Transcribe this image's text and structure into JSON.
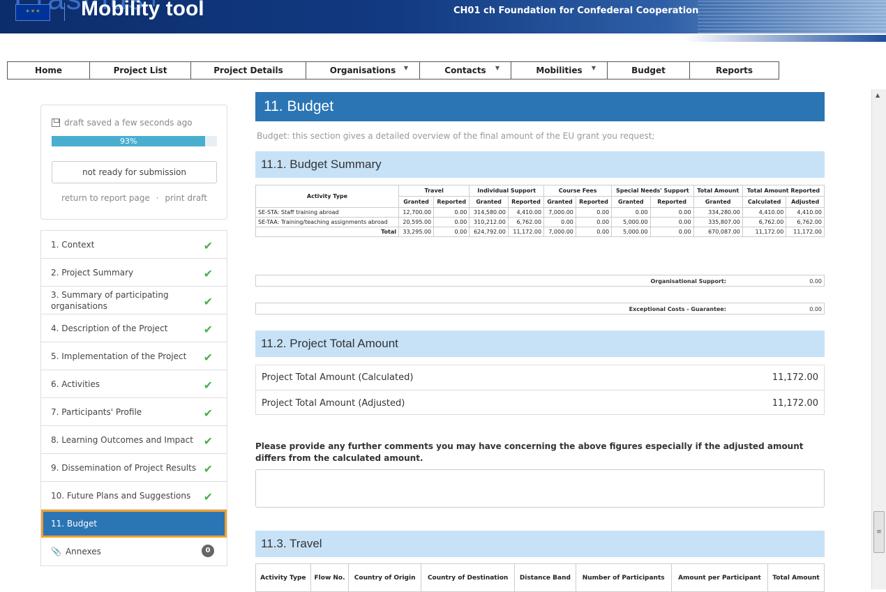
{
  "banner": {
    "ghost_text": "Erasmus+",
    "flag": "* * *",
    "app_name": "Mobility tool",
    "organisation": "CH01 ch Foundation for Confederal Cooperation"
  },
  "nav": {
    "items": [
      {
        "label": "Home"
      },
      {
        "label": "Project List"
      },
      {
        "label": "Project Details"
      },
      {
        "label": "Organisations"
      },
      {
        "label": "Contacts"
      },
      {
        "label": "Mobilities"
      },
      {
        "label": "Budget"
      },
      {
        "label": "Reports"
      }
    ],
    "caret": "▼"
  },
  "status": {
    "saved_text": "draft saved a few seconds ago",
    "progress_text": "93%",
    "progress_value": 93,
    "submission_label": "not ready for submission",
    "return_link": "return to report page",
    "separator": "·",
    "print_link": "print draft"
  },
  "sections": [
    {
      "label": "1. Context",
      "check": "✔"
    },
    {
      "label": "2. Project Summary",
      "check": "✔"
    },
    {
      "label": "3. Summary of participating organisations",
      "check": "✔"
    },
    {
      "label": "4. Description of the Project",
      "check": "✔"
    },
    {
      "label": "5. Implementation of the Project",
      "check": "✔"
    },
    {
      "label": "6. Activities",
      "check": "✔"
    },
    {
      "label": "7. Participants' Profile",
      "check": "✔"
    },
    {
      "label": "8. Learning Outcomes and Impact",
      "check": "✔"
    },
    {
      "label": "9. Dissemination of Project Results",
      "check": "✔"
    },
    {
      "label": "10. Future Plans and Suggestions",
      "check": "✔"
    },
    {
      "label": "11. Budget"
    },
    {
      "label": "Annexes",
      "count": "0"
    }
  ],
  "main": {
    "title": "11. Budget",
    "intro": "Budget: this section gives a detailed overview of the final amount of the EU grant you request;",
    "summary_heading": "11.1. Budget Summary",
    "summary_table": {
      "group_headers": {
        "activity_type": "Activity Type",
        "travel": "Travel",
        "individual_support": "Individual Support",
        "course_fees": "Course Fees",
        "special_needs": "Special Needs' Support",
        "total_amount": "Total Amount",
        "total_reported": "Total Amount Reported"
      },
      "sub_headers": {
        "granted": "Granted",
        "reported": "Reported",
        "calculated": "Calculated",
        "adjusted": "Adjusted"
      },
      "rows": [
        {
          "label": "SE-STA: Staff training abroad",
          "cells": [
            "12,700.00",
            "0.00",
            "314,580.00",
            "4,410.00",
            "7,000.00",
            "0.00",
            "0.00",
            "0.00",
            "334,280.00",
            "4,410.00",
            "4,410.00"
          ]
        },
        {
          "label": "SE-TAA: Training/teaching assignments abroad",
          "cells": [
            "20,595.00",
            "0.00",
            "310,212.00",
            "6,762.00",
            "0.00",
            "0.00",
            "5,000.00",
            "0.00",
            "335,807.00",
            "6,762.00",
            "6,762.00"
          ]
        },
        {
          "label": "Total",
          "cells": [
            "33,295.00",
            "0.00",
            "624,792.00",
            "11,172.00",
            "7,000.00",
            "0.00",
            "5,000.00",
            "0.00",
            "670,087.00",
            "11,172.00",
            "11,172.00"
          ]
        }
      ]
    },
    "organisational_support": {
      "label": "Organisational Support:",
      "value": "0.00"
    },
    "exceptional_costs": {
      "label": "Exceptional Costs - Guarantee:",
      "value": "0.00"
    },
    "total_heading": "11.2. Project Total Amount",
    "total_calculated": {
      "label": "Project Total Amount (Calculated)",
      "value": "11,172.00"
    },
    "total_adjusted": {
      "label": "Project Total Amount (Adjusted)",
      "value": "11,172.00"
    },
    "comments_question": "Please provide any further comments you may have concerning the above figures especially if the adjusted amount differs from the calculated amount.",
    "comments_value": "",
    "travel_heading": "11.3. Travel",
    "travel_columns": [
      "Activity Type",
      "Flow No.",
      "Country of Origin",
      "Country of Destination",
      "Distance Band",
      "Number of Participants",
      "Amount per Participant",
      "Total Amount"
    ]
  },
  "colors": {
    "accent": "#2b75b4",
    "subheading_bg": "#c7e2f7",
    "check": "#4caf50",
    "active_outline": "#f0a030",
    "progress": "#4aaed0"
  }
}
